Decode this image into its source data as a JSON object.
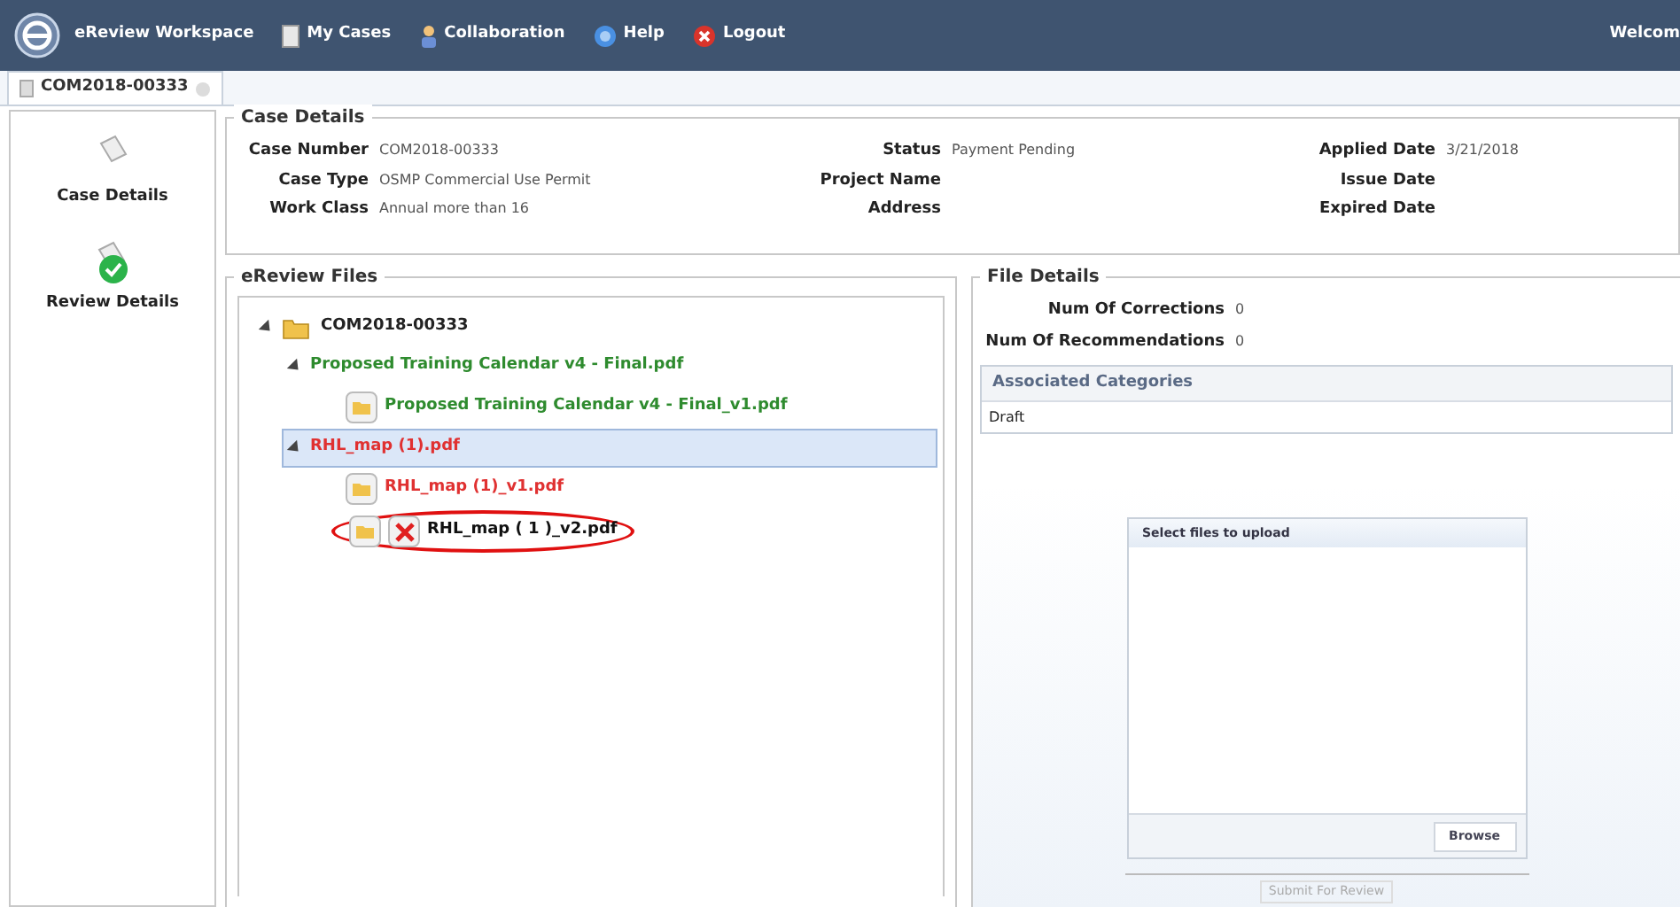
{
  "top_bar": {
    "app_name": "eReview Workspace",
    "menu": [
      {
        "label": "My Cases",
        "kind": "cases"
      },
      {
        "label": "Collaboration",
        "kind": "people"
      },
      {
        "label": "Help",
        "kind": "help"
      },
      {
        "label": "Logout",
        "kind": "logout"
      }
    ],
    "welcome": "Welcom"
  },
  "tabs": [
    {
      "label": "COM2018-00333",
      "selected": true
    }
  ],
  "sidebar": {
    "items": [
      {
        "label": "Case Details",
        "completed": false
      },
      {
        "label": "Review Details",
        "completed": true
      }
    ]
  },
  "case_details": {
    "title": "Case Details",
    "fields": [
      {
        "label": "Case Number",
        "value": "COM2018-00333"
      },
      {
        "label": "Status",
        "value": "Payment Pending"
      },
      {
        "label": "Applied Date",
        "value": "3/21/2018"
      },
      {
        "label": "Case Type",
        "value": "OSMP Commercial Use Permit"
      },
      {
        "label": "Project Name"
      },
      {
        "label": "Issue Date"
      },
      {
        "label": "Work Class",
        "value": "Annual more than 16"
      },
      {
        "label": "Address"
      },
      {
        "label": "Expired Date"
      }
    ]
  },
  "files": {
    "title": "eReview Files",
    "tree": [
      {
        "label": "COM2018-00333",
        "kind": "folder",
        "expanded": true,
        "selected": false,
        "color": "#222222",
        "children": [
          {
            "label": "Proposed Training Calendar v4 - Final.pdf",
            "kind": "file",
            "expanded": true,
            "selected": false,
            "color": "#2e8b2e",
            "children": [
              {
                "label": "Proposed Training Calendar v4 - Final_v1.pdf",
                "kind": "version",
                "selected": false,
                "deletable": false,
                "circled": false,
                "color": "#2e8b2e"
              }
            ]
          },
          {
            "label": "RHL_map (1).pdf",
            "kind": "file",
            "expanded": true,
            "selected": true,
            "color": "#e03131",
            "children": [
              {
                "label": "RHL_map (1)_v1.pdf",
                "kind": "version",
                "selected": false,
                "deletable": false,
                "circled": false,
                "color": "#e03131"
              },
              {
                "label": "RHL_map ( 1 )_v2.pdf",
                "kind": "version",
                "selected": false,
                "deletable": true,
                "circled": true,
                "color": "#111111"
              }
            ]
          }
        ]
      }
    ]
  },
  "file_details": {
    "title": "File Details",
    "fields": [
      {
        "label": "Num Of Corrections",
        "value": "0"
      },
      {
        "label": "Num Of Recommendations",
        "value": "0"
      }
    ],
    "categories": {
      "header": "Associated Categories",
      "rows": [
        "Draft"
      ]
    },
    "upload": {
      "title": "Select files to upload",
      "browse": "Browse",
      "submit": "Submit For Review",
      "submit_disabled": true
    }
  }
}
